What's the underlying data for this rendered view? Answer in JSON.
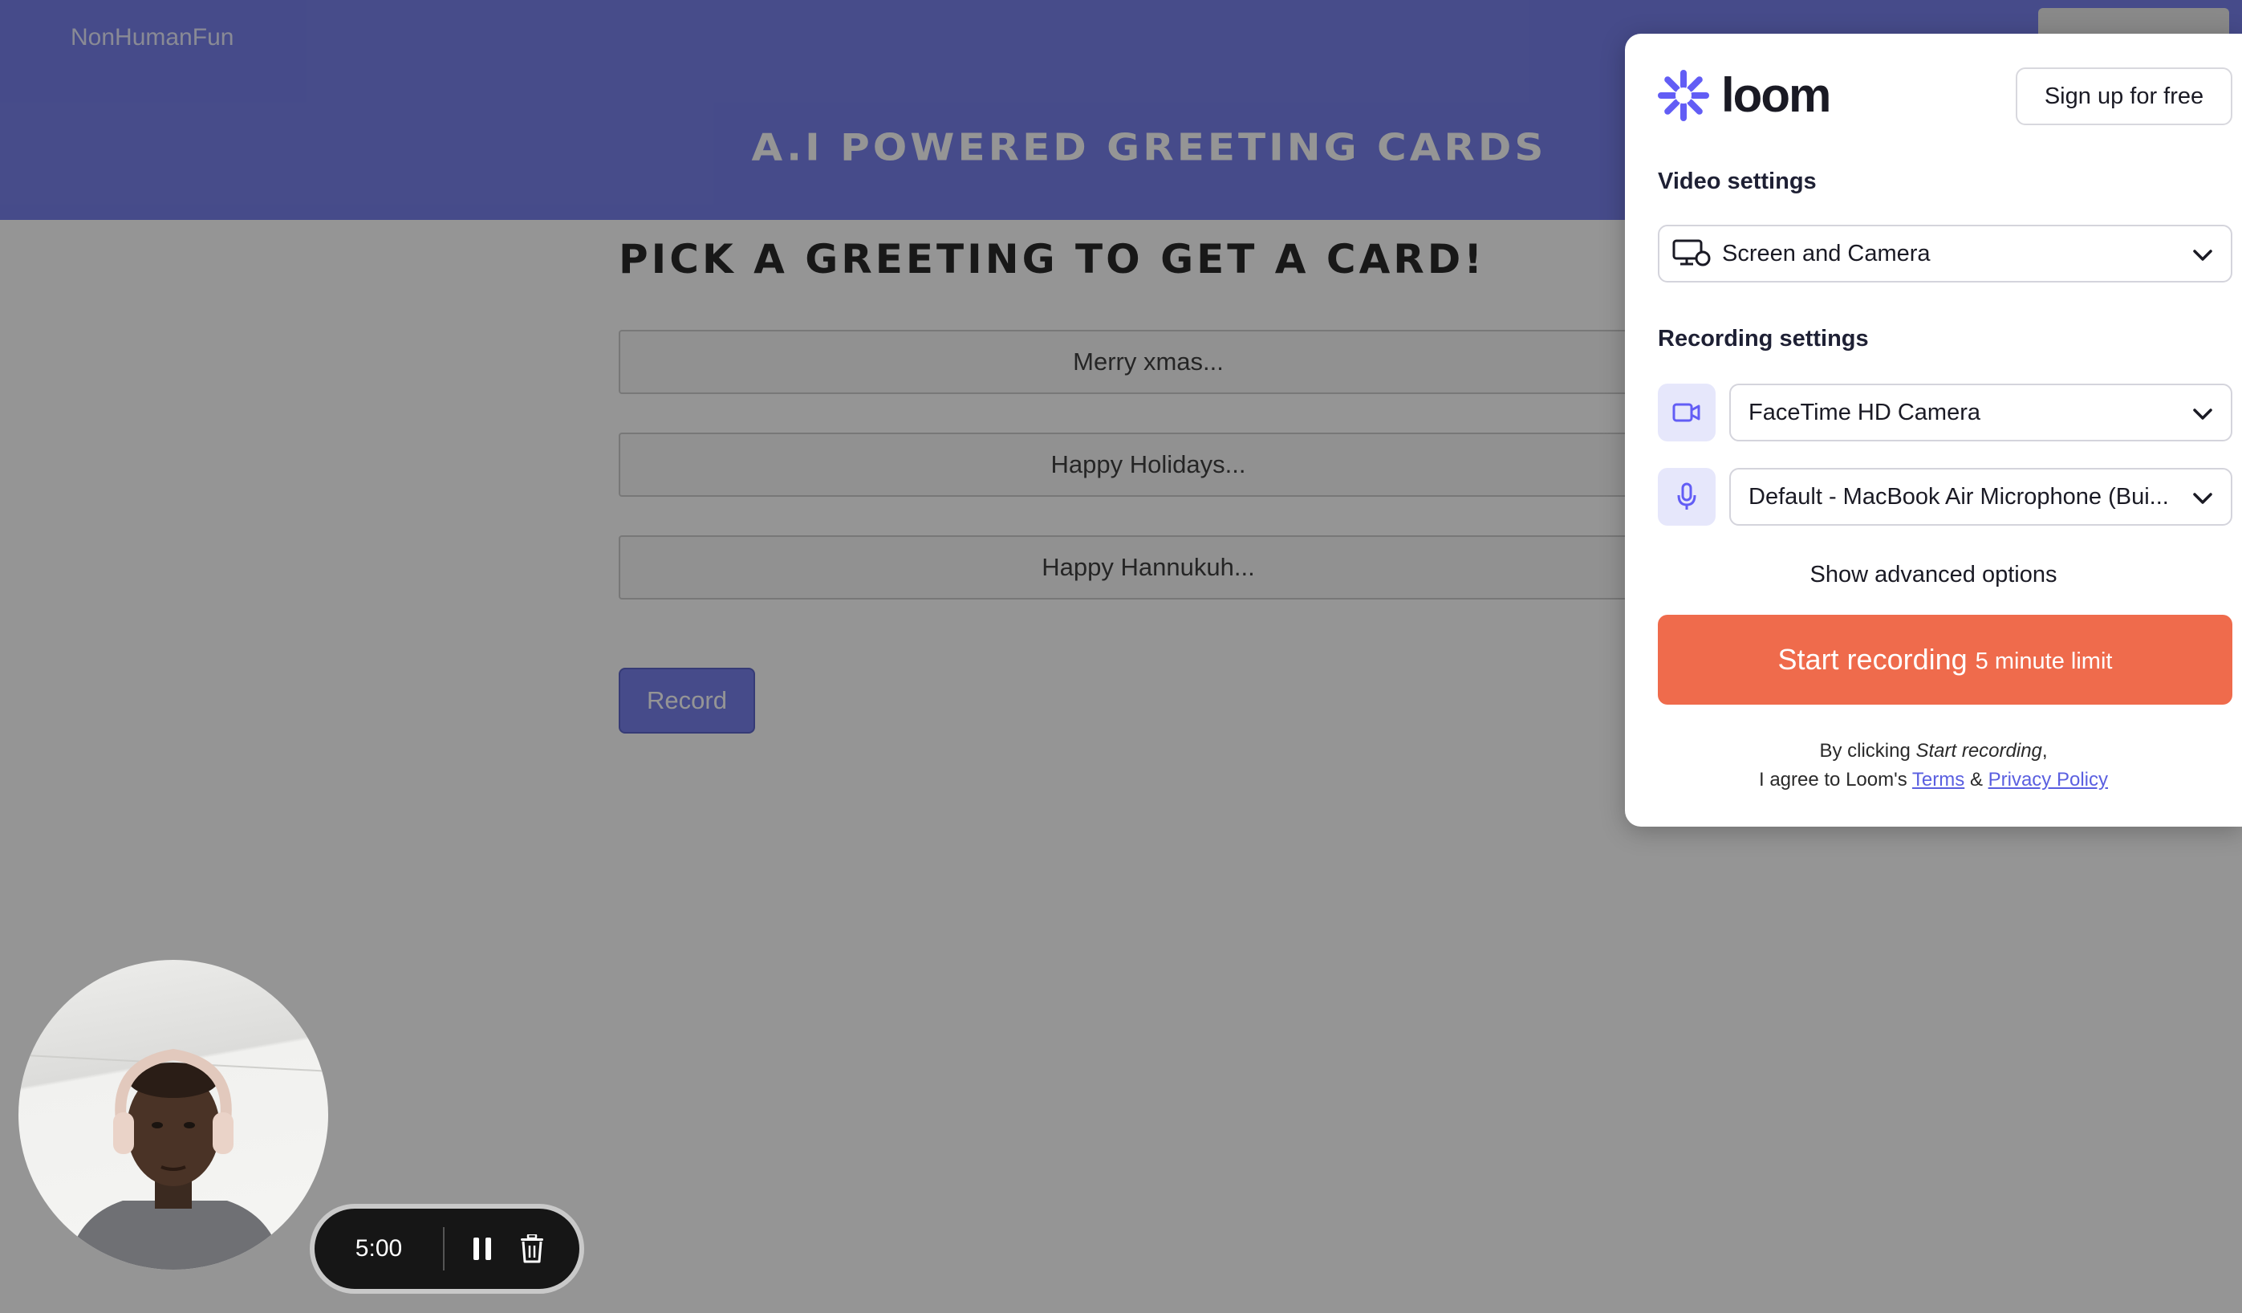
{
  "page": {
    "brand": "NonHumanFun",
    "header_title": "A.I Powered Greeting Cards",
    "heading": "Pick a greeting to get a card!",
    "greetings": [
      "Merry xmas...",
      "Happy Holidays...",
      "Happy Hannukuh..."
    ],
    "record_label": "Record"
  },
  "recorder": {
    "timer": "5:00",
    "pause_icon": "pause-icon",
    "delete_icon": "trash-icon"
  },
  "loom": {
    "logo_text": "loom",
    "signup_label": "Sign up for free",
    "video_settings_label": "Video settings",
    "video_mode": "Screen and Camera",
    "recording_settings_label": "Recording settings",
    "camera": "FaceTime HD Camera",
    "microphone": "Default - MacBook Air Microphone (Bui...",
    "advanced_label": "Show advanced options",
    "start_label": "Start recording",
    "start_sublabel": "5 minute limit",
    "legal_prefix": "By clicking ",
    "legal_emph": "Start recording",
    "legal_line2_prefix": "I agree to Loom's ",
    "terms_label": "Terms",
    "amp": "&",
    "privacy_label": "Privacy Policy"
  },
  "colors": {
    "header_bg": "#6872ea",
    "accent": "#625df5",
    "start_button": "#ef6b4c"
  }
}
